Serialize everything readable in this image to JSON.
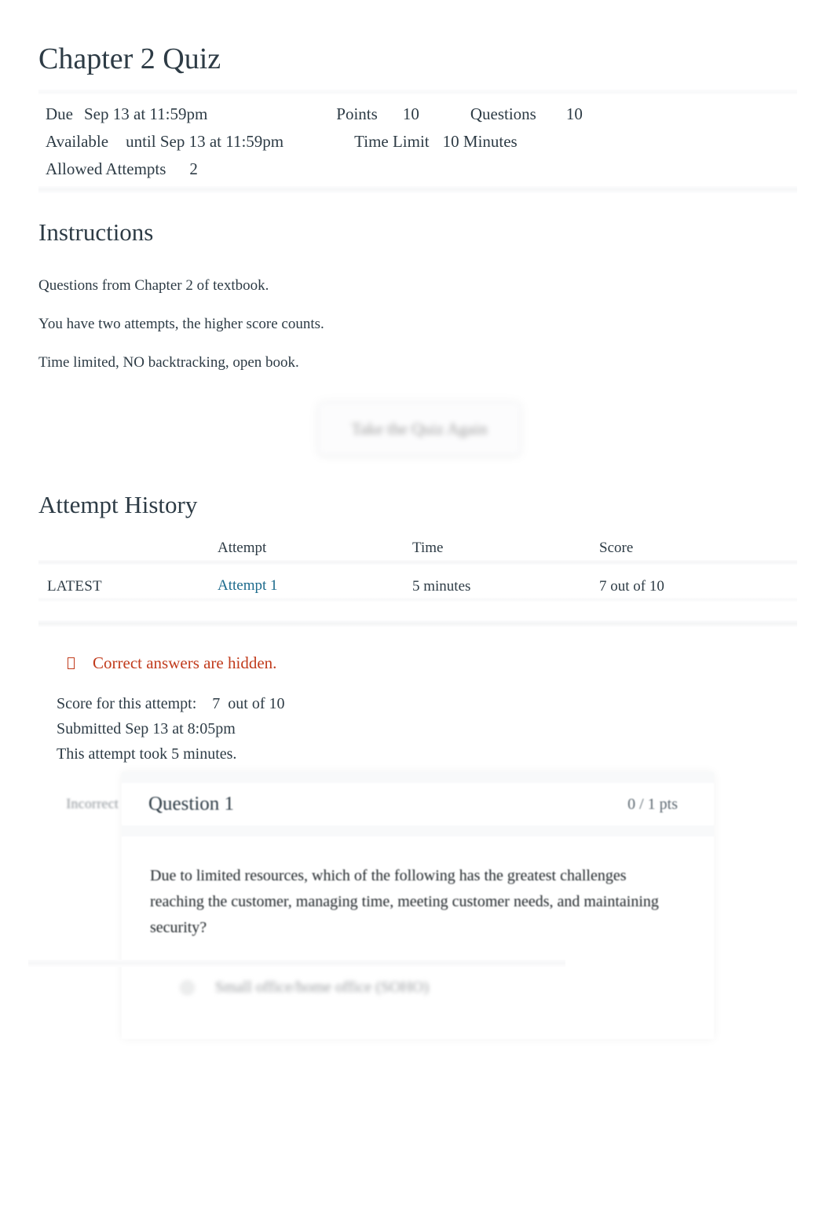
{
  "quiz": {
    "title": "Chapter 2 Quiz",
    "info": {
      "due_label": "Due",
      "due_value": "Sep 13 at 11:59pm",
      "points_label": "Points",
      "points_value": "10",
      "questions_label": "Questions",
      "questions_value": "10",
      "available_label": "Available",
      "available_value": "until Sep 13 at 11:59pm",
      "time_limit_label": "Time Limit",
      "time_limit_value": "10 Minutes",
      "allowed_attempts_label": "Allowed Attempts",
      "allowed_attempts_value": "2"
    }
  },
  "instructions": {
    "heading": "Instructions",
    "paragraphs": [
      "Questions from Chapter 2 of textbook.",
      "You have two attempts, the higher score counts.",
      "Time limited, NO backtracking, open book."
    ]
  },
  "retake": {
    "label": "Take the Quiz Again"
  },
  "attempt_history": {
    "heading": "Attempt History",
    "columns": [
      "",
      "Attempt",
      "Time",
      "Score"
    ],
    "rows": [
      {
        "flag": "LATEST",
        "attempt": "Attempt 1",
        "time": "5 minutes",
        "score": "7 out of 10"
      }
    ]
  },
  "notice": {
    "icon": "warning-icon",
    "text": "Correct answers are hidden."
  },
  "attempt_summary": {
    "score_label": "Score for this attempt:",
    "score_value": "7",
    "score_outof": "out of 10",
    "submitted": "Submitted Sep 13 at 8:05pm",
    "duration": "This attempt took 5 minutes."
  },
  "question": {
    "status": "Incorrect",
    "name": "Question 1",
    "points": "0 / 1 pts",
    "text": "Due to limited resources, which of the following has the greatest challenges reaching the customer, managing time, meeting customer needs, and maintaining security?",
    "answers": [
      {
        "label": "Small office/home office (SOHO)"
      }
    ]
  },
  "colors": {
    "link": "#1c6a8c",
    "warning": "#c13b1c",
    "text": "#2d3b45",
    "muted": "#8f959a"
  }
}
